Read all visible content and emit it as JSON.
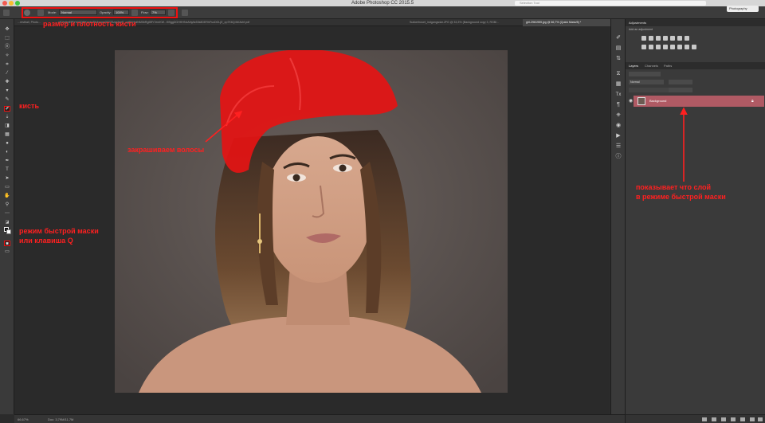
{
  "window": {
    "title": "Adobe Photoshop CC 2015.5",
    "search_placeholder": "Selection Tool",
    "workspace": "Photography"
  },
  "options_bar": {
    "mode_label": "Mode:",
    "mode_value": "Normal",
    "opacity_label": "Opacity:",
    "opacity_value": "100%",
    "flow_label": "Flow:",
    "flow_value": "7%"
  },
  "tabs": [
    {
      "label": "...resthall, Photo...",
      "active": false
    },
    {
      "label": "...ufOhdjmEfPYh33Q8tKmdsISb3waoe2027Ezqr3eeE_oqRXHrdNM0bRgIBFr7emKW...f09ggDGHHHNxAihjAk53k8DERhFsoDGLjE_op7K6Q4MJwhf.pdf",
      "active": false
    },
    {
      "label": "Sukkerhuset_indgangsdør.JPG @ 33,3% (Background copy 3, RGB/...",
      "active": false
    },
    {
      "label": "girl-2961959.jpg @ 66,7% (Quick Mask/8) *",
      "active": true
    }
  ],
  "status": {
    "zoom": "66,67%",
    "doc": "Doc: 3,79M/11,7M"
  },
  "panels": {
    "adjustments_title": "Adjustments",
    "adjustments_subtitle": "Add an adjustment",
    "layers_tabs": [
      "Layers",
      "Channels",
      "Paths"
    ],
    "blend_mode": "Normal",
    "layer_name": "Background"
  },
  "annotations": {
    "brush_size": "размер и плотность кисти",
    "brush": "кисть",
    "paint_hair": "закрашиваем волосы",
    "quick_mask_line1": "режим быстрой маски",
    "quick_mask_line2": "или клавиша Q",
    "layer_note_line1": "показывает что слой",
    "layer_note_line2": "в режиме быстрой маски"
  },
  "colors": {
    "annotation": "#ff2020",
    "quick_mask_overlay": "#e51313",
    "layer_highlight": "#b05a64"
  }
}
